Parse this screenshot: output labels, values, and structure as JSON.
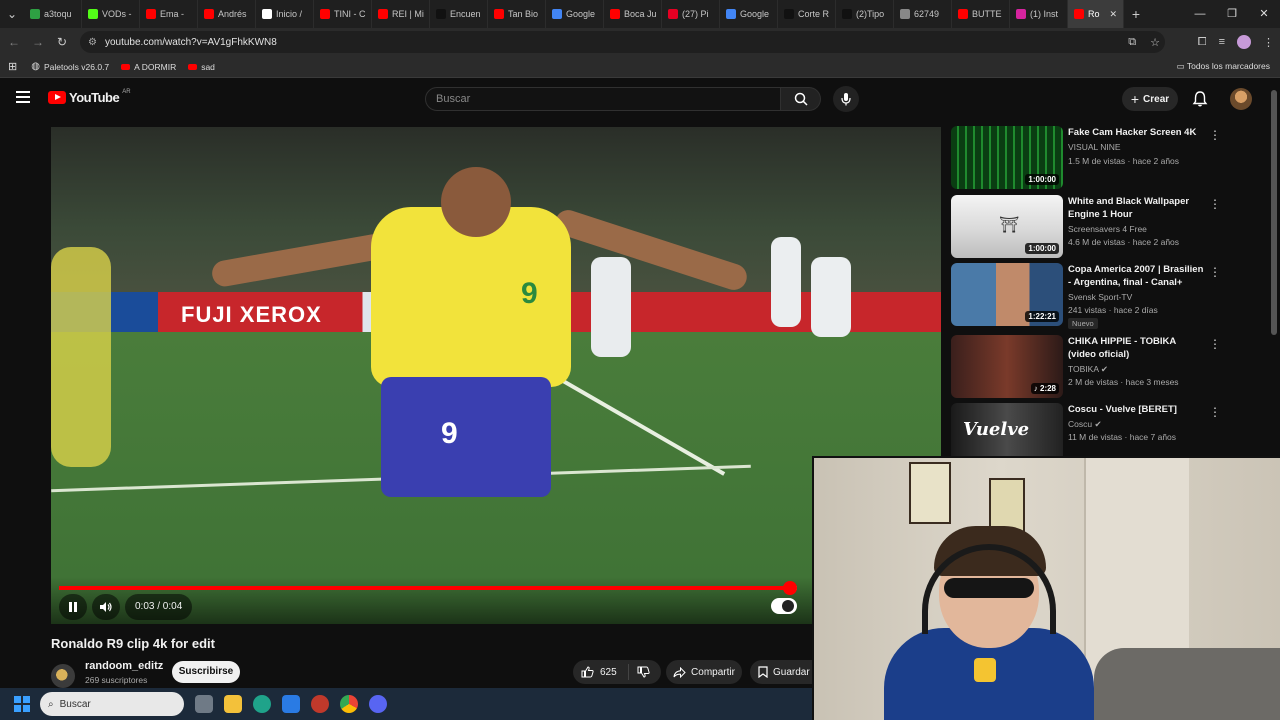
{
  "browser": {
    "tabs": [
      {
        "label": "a3toqu",
        "color": "#2ea043"
      },
      {
        "label": "VODs -",
        "color": "#53fc18"
      },
      {
        "label": "Ema -",
        "color": "#ff0000"
      },
      {
        "label": "Andrés",
        "color": "#ff0000"
      },
      {
        "label": "Inicio /",
        "color": "#ffffff"
      },
      {
        "label": "TINI - C",
        "color": "#ff0000"
      },
      {
        "label": "REI | Mi",
        "color": "#ff0000"
      },
      {
        "label": "Encuen",
        "color": "#111111"
      },
      {
        "label": "Tan Bio",
        "color": "#ff0000"
      },
      {
        "label": "Google",
        "color": "#4285f4"
      },
      {
        "label": "Boca Ju",
        "color": "#ff0000"
      },
      {
        "label": "(27) Pi",
        "color": "#e60023"
      },
      {
        "label": "Google",
        "color": "#4285f4"
      },
      {
        "label": "Corte R",
        "color": "#111111"
      },
      {
        "label": "(2)Tipo",
        "color": "#111111"
      },
      {
        "label": "62749",
        "color": "#888888"
      },
      {
        "label": "BUTTE",
        "color": "#ff0000"
      },
      {
        "label": "(1) Inst",
        "color": "#d6249f"
      }
    ],
    "active_tab": {
      "label": "Ro",
      "color": "#ff0000"
    },
    "url": "youtube.com/watch?v=AV1gFhkKWN8",
    "bookmarks": [
      {
        "label": "Paletools v26.0.7"
      },
      {
        "label": "A DORMIR"
      },
      {
        "label": "sad"
      }
    ],
    "all_bookmarks": "Todos los marcadores"
  },
  "header": {
    "logo_text": "YouTube",
    "country_code": "AR",
    "search_placeholder": "Buscar",
    "create_label": "Crear"
  },
  "player": {
    "current_time": "0:03",
    "duration": "0:04",
    "time_display": "0:03 / 0:04",
    "progress_fraction": 0.99,
    "adboard_text": "FUJI XEROX",
    "shirt_number": "9"
  },
  "video": {
    "title": "Ronaldo R9 clip 4k for edit",
    "channel": "randoom_editz",
    "subscribers": "269 suscriptores",
    "subscribe_label": "Suscribirse",
    "likes": "625",
    "share_label": "Compartir",
    "save_label": "Guardar"
  },
  "recommendations": [
    {
      "title": "Fake Cam Hacker Screen 4K",
      "channel": "VISUAL NINE",
      "meta": "1.5 M de vistas · hace 2 años",
      "duration": "1:00:00",
      "badge": ""
    },
    {
      "title": "White and Black Wallpaper Engine 1 Hour",
      "channel": "Screensavers 4 Free",
      "meta": "4.6 M de vistas · hace 2 años",
      "duration": "1:00:00",
      "badge": ""
    },
    {
      "title": "Copa America 2007 | Brasilien - Argentina, final - Canal+",
      "channel": "Svensk Sport-TV",
      "meta": "241 vistas · hace 2 días",
      "duration": "1:22:21",
      "badge": "Nuevo"
    },
    {
      "title": "CHIKA HIPPIE - TOBIKA (video oficial)",
      "channel": "TOBIKA ✔",
      "meta": "2 M de vistas · hace 3 meses",
      "duration": "♪ 2:28",
      "badge": ""
    },
    {
      "title": "Coscu - Vuelve [BERET]",
      "channel": "Coscu ✔",
      "meta": "11 M de vistas · hace 7 años",
      "duration": "",
      "badge": "",
      "thumb_text": "Vuelve"
    }
  ],
  "taskbar": {
    "search_label": "Buscar"
  }
}
